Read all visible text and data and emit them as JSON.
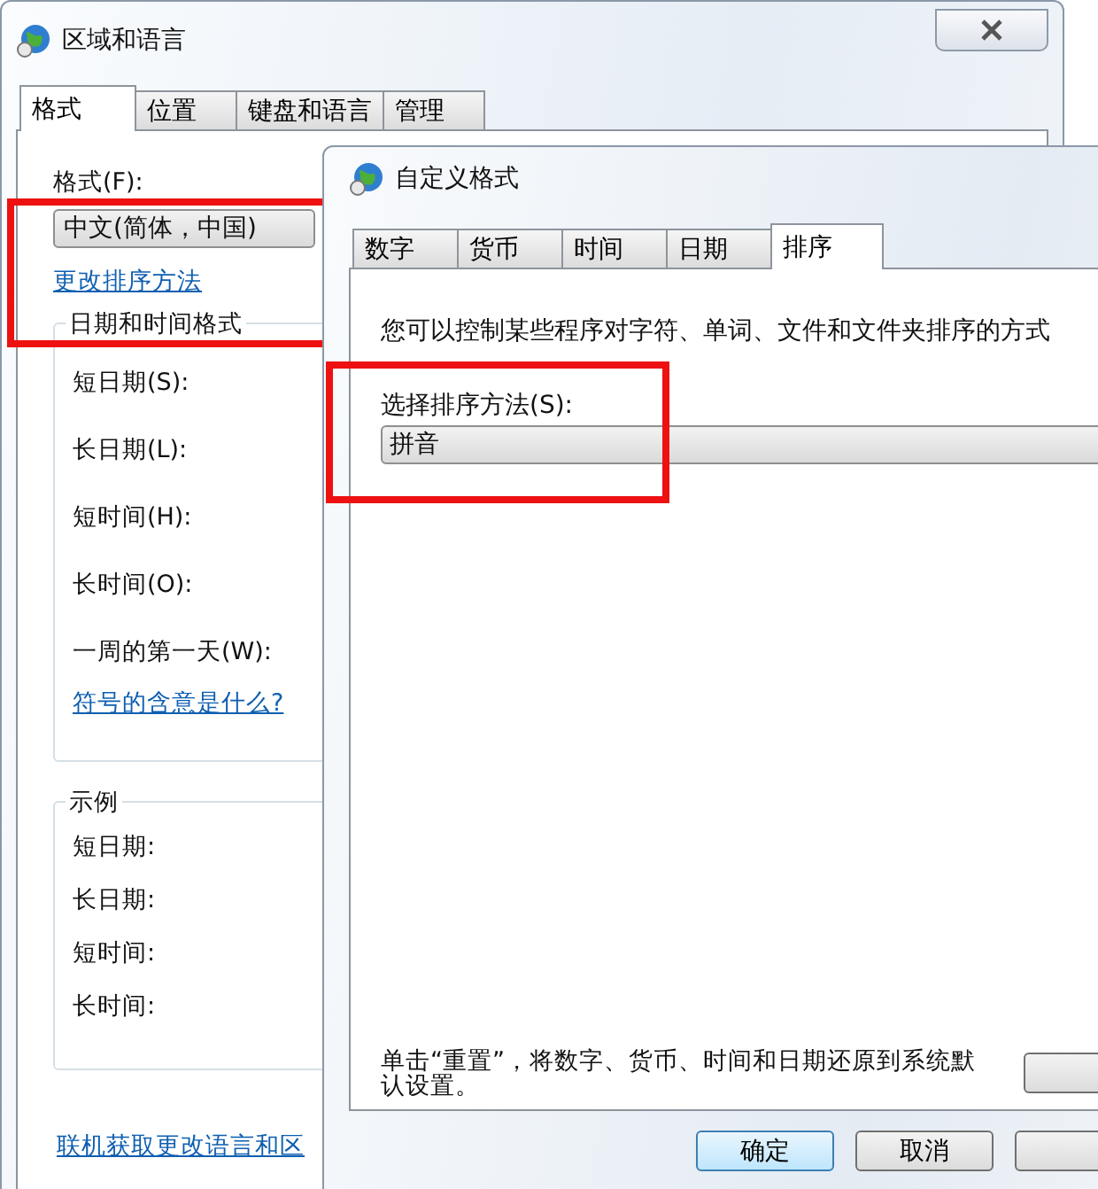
{
  "back_window": {
    "title": "区域和语言",
    "tabs": [
      {
        "label": "格式",
        "selected": true
      },
      {
        "label": "位置",
        "selected": false
      },
      {
        "label": "键盘和语言",
        "selected": false
      },
      {
        "label": "管理",
        "selected": false
      }
    ],
    "format_label": "格式(F):",
    "format_value": "中文(简体，中国)",
    "sort_link": "更改排序方法",
    "datetime_group": {
      "title": "日期和时间格式",
      "fields": [
        "短日期(S):",
        "长日期(L):",
        "短时间(H):",
        "长时间(O):",
        "一周的第一天(W):"
      ]
    },
    "symbols_link": "符号的含意是什么?",
    "example_group": {
      "title": "示例",
      "fields": [
        "短日期:",
        "长日期:",
        "短时间:",
        "长时间:"
      ]
    },
    "online_link": "联机获取更改语言和区"
  },
  "front_window": {
    "title": "自定义格式",
    "tabs": [
      {
        "label": "数字",
        "selected": false
      },
      {
        "label": "货币",
        "selected": false
      },
      {
        "label": "时间",
        "selected": false
      },
      {
        "label": "日期",
        "selected": false
      },
      {
        "label": "排序",
        "selected": true
      }
    ],
    "description": "您可以控制某些程序对字符、单词、文件和文件夹排序的方式",
    "sort_label": "选择排序方法(S):",
    "sort_value": "拼音",
    "reset_note": "单击“重置”，将数字、货币、时间和日期还原到系统默认设置。",
    "buttons": [
      {
        "label": "确定",
        "default": true
      },
      {
        "label": "取消",
        "default": false
      }
    ]
  }
}
